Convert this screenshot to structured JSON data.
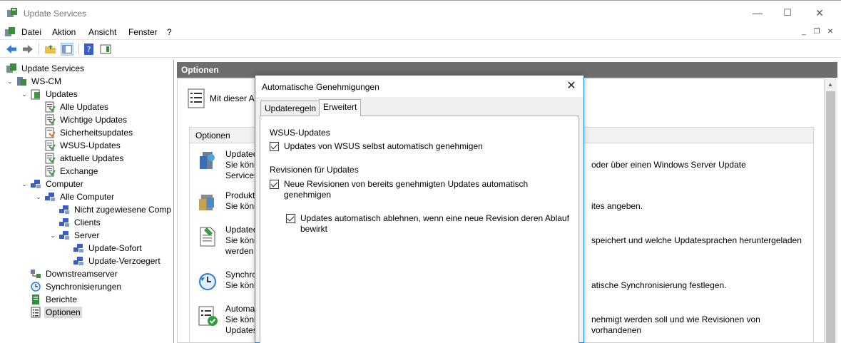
{
  "window": {
    "title": "Update Services",
    "min": "—",
    "max": "☐",
    "close": "✕"
  },
  "menu": {
    "items": [
      "Datei",
      "Aktion",
      "Ansicht",
      "Fenster",
      "?"
    ],
    "child_min": "_",
    "child_restore": "❐",
    "child_close": "✕"
  },
  "tree": [
    {
      "label": "Update Services",
      "expander": "",
      "icon": "update-services-icon"
    },
    {
      "label": "WS-CM",
      "expander": "⌄",
      "icon": "server-icon"
    },
    {
      "label": "Updates",
      "expander": "⌄",
      "icon": "updates-icon"
    },
    {
      "label": "Alle Updates",
      "expander": "",
      "icon": "update-list-icon"
    },
    {
      "label": "Wichtige Updates",
      "expander": "",
      "icon": "update-list-icon"
    },
    {
      "label": "Sicherheitsupdates",
      "expander": "",
      "icon": "security-update-icon"
    },
    {
      "label": "WSUS-Updates",
      "expander": "",
      "icon": "update-list-icon"
    },
    {
      "label": "aktuelle Updates",
      "expander": "",
      "icon": "update-list-icon"
    },
    {
      "label": "Exchange",
      "expander": "",
      "icon": "update-list-icon"
    },
    {
      "label": "Computer",
      "expander": "⌄",
      "icon": "computers-icon"
    },
    {
      "label": "Alle Computer",
      "expander": "⌄",
      "icon": "computers-icon"
    },
    {
      "label": "Nicht zugewiesene Comp",
      "expander": "",
      "icon": "computers-icon"
    },
    {
      "label": "Clients",
      "expander": "",
      "icon": "computers-icon"
    },
    {
      "label": "Server",
      "expander": "⌄",
      "icon": "computers-icon"
    },
    {
      "label": "Update-Sofort",
      "expander": "",
      "icon": "computers-icon"
    },
    {
      "label": "Update-Verzoegert",
      "expander": "",
      "icon": "computers-icon"
    },
    {
      "label": "Downstreamserver",
      "expander": "",
      "icon": "downstream-icon"
    },
    {
      "label": "Synchronisierungen",
      "expander": "",
      "icon": "sync-icon"
    },
    {
      "label": "Berichte",
      "expander": "",
      "icon": "reports-icon"
    },
    {
      "label": "Optionen",
      "expander": "",
      "icon": "options-icon"
    }
  ],
  "pane": {
    "header": "Optionen",
    "intro": "Mit dieser A",
    "options_header": "Optionen",
    "options": [
      {
        "title": "Updatequelle",
        "visible_title": "Updatec",
        "desc1": "Sie könr",
        "desc1_right": "oder über einen Windows Server Update",
        "desc2": "Services"
      },
      {
        "title": "Produkte",
        "visible_title": "Produkt",
        "desc1": "Sie könr",
        "desc1_right": "ites angeben.",
        "desc2": ""
      },
      {
        "title": "Updatedateien",
        "visible_title": "Updatec",
        "desc1": "Sie könr",
        "desc1_right": "speichert und welche Updatesprachen heruntergeladen",
        "desc2": "werden"
      },
      {
        "title": "Synchronisierung",
        "visible_title": "Synchro",
        "desc1": "Sie könr",
        "desc1_right": "atische Synchronisierung festlegen.",
        "desc2": ""
      },
      {
        "title": "Automatische Genehmigungen",
        "visible_title": "Automa",
        "desc1": "Sie könr",
        "desc1_right": "nehmigt werden soll und wie Revisionen von vorhandenen",
        "desc2": "Updates"
      }
    ]
  },
  "dialog": {
    "title": "Automatische Genehmigungen",
    "close": "✕",
    "tabs": [
      "Updateregeln",
      "Erweitert"
    ],
    "group1": "WSUS-Updates",
    "chk1": "Updates von WSUS selbst automatisch genehmigen",
    "group2": "Revisionen für Updates",
    "chk2": "Neue Revisionen von bereits genehmigten Updates automatisch genehmigen",
    "chk3": "Updates automatisch ablehnen, wenn eine neue Revision deren Ablauf bewirkt"
  },
  "colors": {
    "accent": "#1883d7",
    "pane_header": "#6d6d6d"
  }
}
